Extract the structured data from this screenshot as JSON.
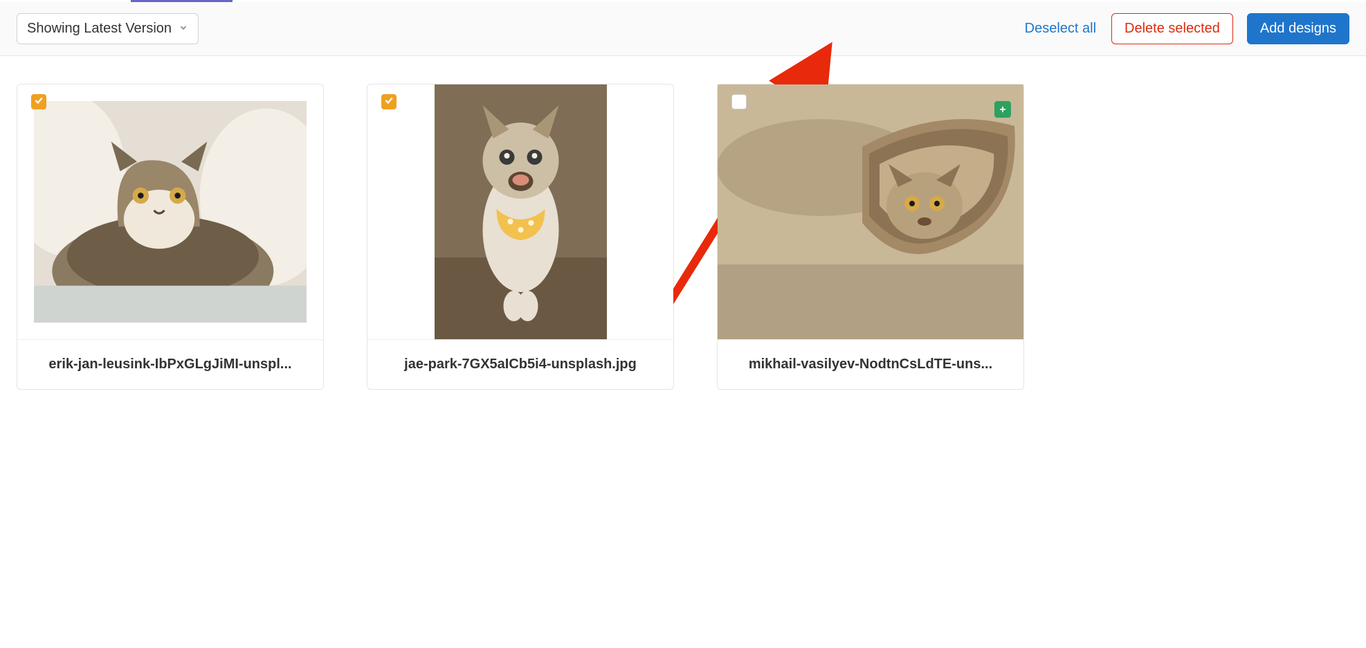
{
  "toolbar": {
    "version_label": "Showing Latest Version",
    "deselect_label": "Deselect all",
    "delete_label": "Delete selected",
    "add_label": "Add designs"
  },
  "designs": [
    {
      "filename": "erik-jan-leusink-IbPxGLgJiMI-unspl...",
      "selected": true
    },
    {
      "filename": "jae-park-7GX5aICb5i4-unsplash.jpg",
      "selected": true
    },
    {
      "filename": "mikhail-vasilyev-NodtnCsLdTE-uns...",
      "selected": false
    }
  ]
}
